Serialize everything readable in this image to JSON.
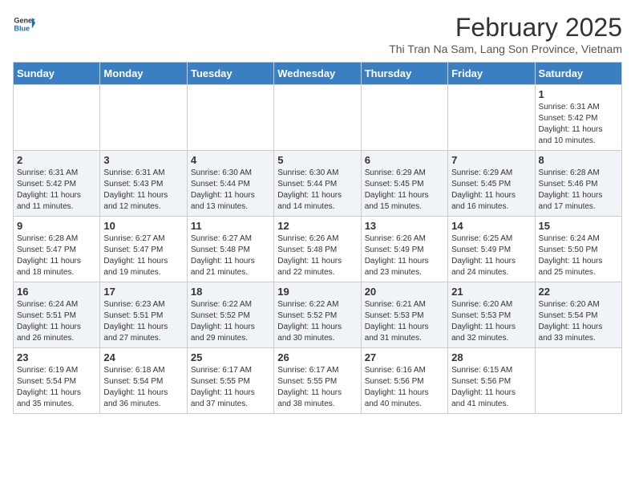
{
  "header": {
    "logo_line1": "General",
    "logo_line2": "Blue",
    "month_year": "February 2025",
    "location": "Thi Tran Na Sam, Lang Son Province, Vietnam"
  },
  "weekdays": [
    "Sunday",
    "Monday",
    "Tuesday",
    "Wednesday",
    "Thursday",
    "Friday",
    "Saturday"
  ],
  "weeks": [
    [
      {
        "day": "",
        "info": ""
      },
      {
        "day": "",
        "info": ""
      },
      {
        "day": "",
        "info": ""
      },
      {
        "day": "",
        "info": ""
      },
      {
        "day": "",
        "info": ""
      },
      {
        "day": "",
        "info": ""
      },
      {
        "day": "1",
        "info": "Sunrise: 6:31 AM\nSunset: 5:42 PM\nDaylight: 11 hours\nand 10 minutes."
      }
    ],
    [
      {
        "day": "2",
        "info": "Sunrise: 6:31 AM\nSunset: 5:42 PM\nDaylight: 11 hours\nand 11 minutes."
      },
      {
        "day": "3",
        "info": "Sunrise: 6:31 AM\nSunset: 5:43 PM\nDaylight: 11 hours\nand 12 minutes."
      },
      {
        "day": "4",
        "info": "Sunrise: 6:30 AM\nSunset: 5:44 PM\nDaylight: 11 hours\nand 13 minutes."
      },
      {
        "day": "5",
        "info": "Sunrise: 6:30 AM\nSunset: 5:44 PM\nDaylight: 11 hours\nand 14 minutes."
      },
      {
        "day": "6",
        "info": "Sunrise: 6:29 AM\nSunset: 5:45 PM\nDaylight: 11 hours\nand 15 minutes."
      },
      {
        "day": "7",
        "info": "Sunrise: 6:29 AM\nSunset: 5:45 PM\nDaylight: 11 hours\nand 16 minutes."
      },
      {
        "day": "8",
        "info": "Sunrise: 6:28 AM\nSunset: 5:46 PM\nDaylight: 11 hours\nand 17 minutes."
      }
    ],
    [
      {
        "day": "9",
        "info": "Sunrise: 6:28 AM\nSunset: 5:47 PM\nDaylight: 11 hours\nand 18 minutes."
      },
      {
        "day": "10",
        "info": "Sunrise: 6:27 AM\nSunset: 5:47 PM\nDaylight: 11 hours\nand 19 minutes."
      },
      {
        "day": "11",
        "info": "Sunrise: 6:27 AM\nSunset: 5:48 PM\nDaylight: 11 hours\nand 21 minutes."
      },
      {
        "day": "12",
        "info": "Sunrise: 6:26 AM\nSunset: 5:48 PM\nDaylight: 11 hours\nand 22 minutes."
      },
      {
        "day": "13",
        "info": "Sunrise: 6:26 AM\nSunset: 5:49 PM\nDaylight: 11 hours\nand 23 minutes."
      },
      {
        "day": "14",
        "info": "Sunrise: 6:25 AM\nSunset: 5:49 PM\nDaylight: 11 hours\nand 24 minutes."
      },
      {
        "day": "15",
        "info": "Sunrise: 6:24 AM\nSunset: 5:50 PM\nDaylight: 11 hours\nand 25 minutes."
      }
    ],
    [
      {
        "day": "16",
        "info": "Sunrise: 6:24 AM\nSunset: 5:51 PM\nDaylight: 11 hours\nand 26 minutes."
      },
      {
        "day": "17",
        "info": "Sunrise: 6:23 AM\nSunset: 5:51 PM\nDaylight: 11 hours\nand 27 minutes."
      },
      {
        "day": "18",
        "info": "Sunrise: 6:22 AM\nSunset: 5:52 PM\nDaylight: 11 hours\nand 29 minutes."
      },
      {
        "day": "19",
        "info": "Sunrise: 6:22 AM\nSunset: 5:52 PM\nDaylight: 11 hours\nand 30 minutes."
      },
      {
        "day": "20",
        "info": "Sunrise: 6:21 AM\nSunset: 5:53 PM\nDaylight: 11 hours\nand 31 minutes."
      },
      {
        "day": "21",
        "info": "Sunrise: 6:20 AM\nSunset: 5:53 PM\nDaylight: 11 hours\nand 32 minutes."
      },
      {
        "day": "22",
        "info": "Sunrise: 6:20 AM\nSunset: 5:54 PM\nDaylight: 11 hours\nand 33 minutes."
      }
    ],
    [
      {
        "day": "23",
        "info": "Sunrise: 6:19 AM\nSunset: 5:54 PM\nDaylight: 11 hours\nand 35 minutes."
      },
      {
        "day": "24",
        "info": "Sunrise: 6:18 AM\nSunset: 5:54 PM\nDaylight: 11 hours\nand 36 minutes."
      },
      {
        "day": "25",
        "info": "Sunrise: 6:17 AM\nSunset: 5:55 PM\nDaylight: 11 hours\nand 37 minutes."
      },
      {
        "day": "26",
        "info": "Sunrise: 6:17 AM\nSunset: 5:55 PM\nDaylight: 11 hours\nand 38 minutes."
      },
      {
        "day": "27",
        "info": "Sunrise: 6:16 AM\nSunset: 5:56 PM\nDaylight: 11 hours\nand 40 minutes."
      },
      {
        "day": "28",
        "info": "Sunrise: 6:15 AM\nSunset: 5:56 PM\nDaylight: 11 hours\nand 41 minutes."
      },
      {
        "day": "",
        "info": ""
      }
    ]
  ]
}
